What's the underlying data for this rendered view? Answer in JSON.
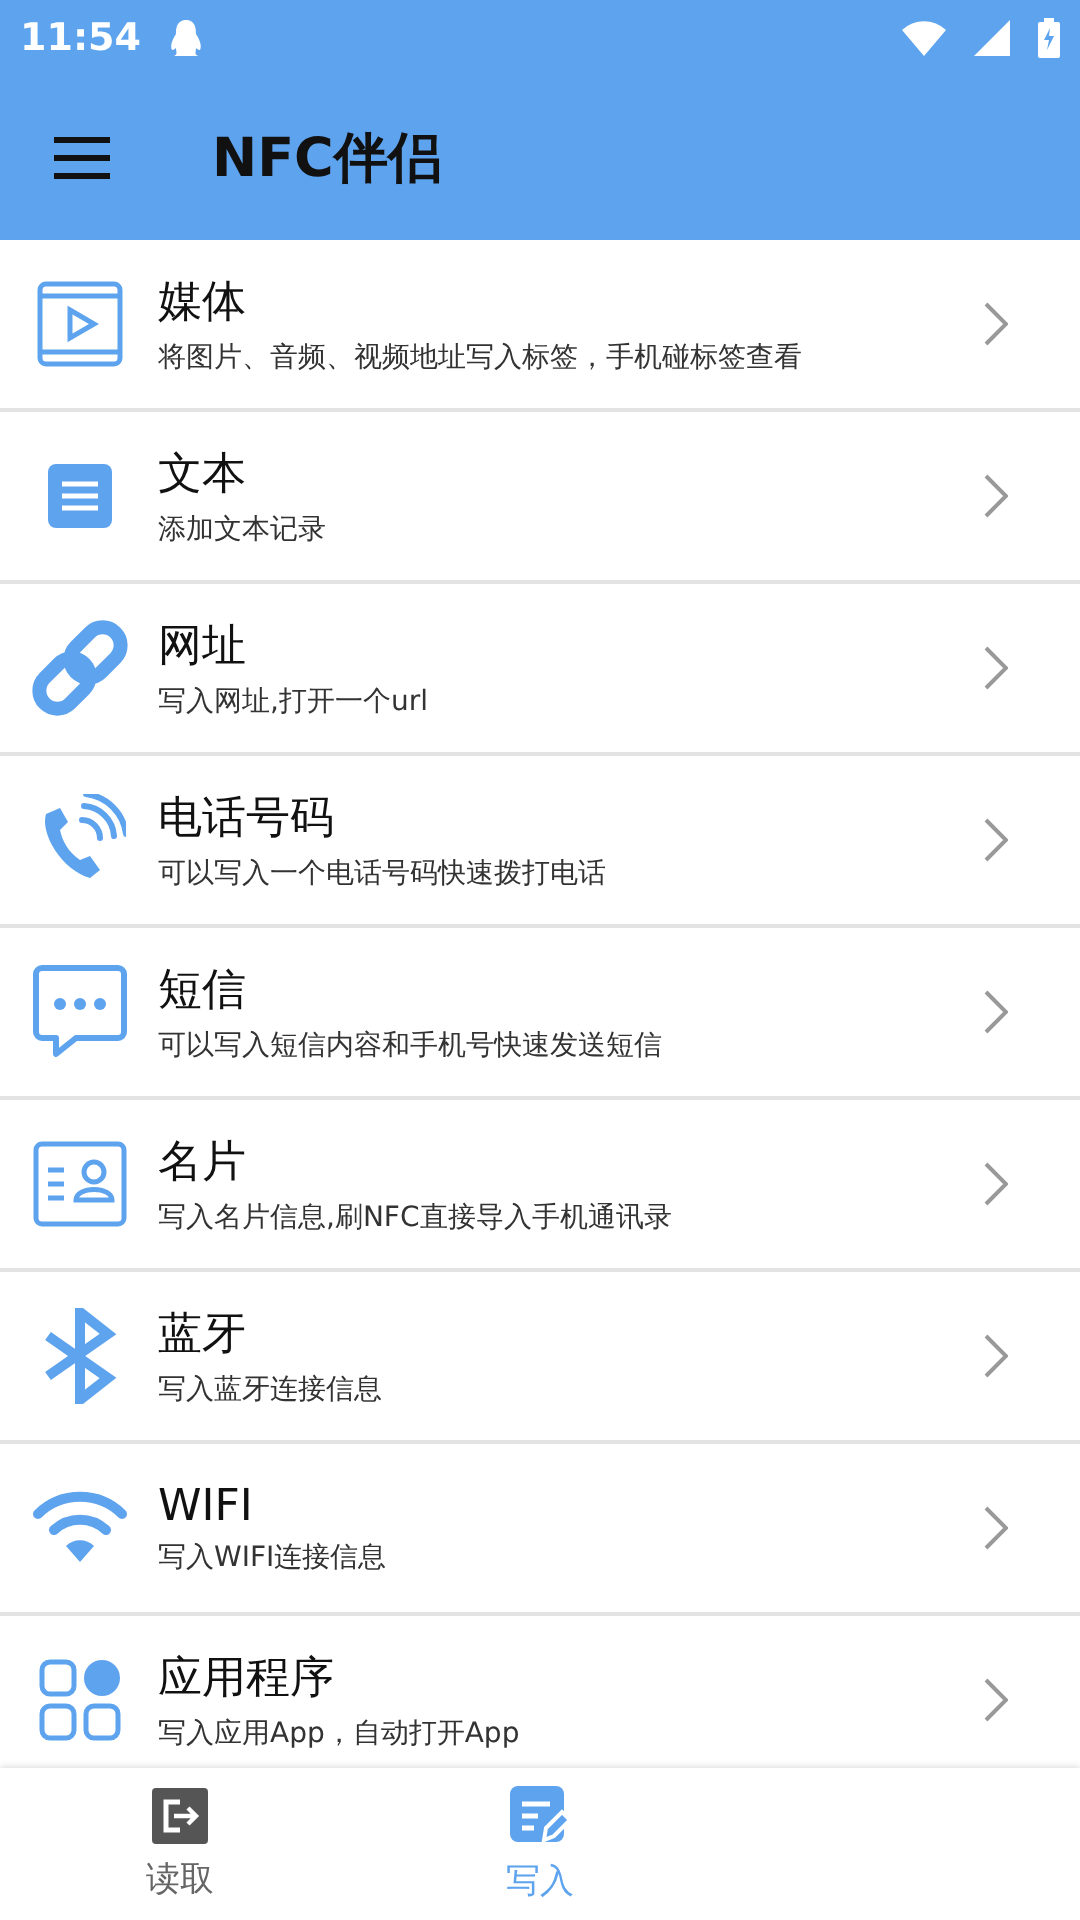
{
  "status_bar": {
    "time": "11:54"
  },
  "app_bar": {
    "title": "NFC伴侣"
  },
  "items": [
    {
      "kind": "media",
      "title": "媒体",
      "subtitle": "将图片、音频、视频地址写入标签，手机碰标签查看"
    },
    {
      "kind": "text",
      "title": "文本",
      "subtitle": "添加文本记录"
    },
    {
      "kind": "link",
      "title": "网址",
      "subtitle": "写入网址,打开一个url"
    },
    {
      "kind": "phone",
      "title": "电话号码",
      "subtitle": "可以写入一个电话号码快速拨打电话"
    },
    {
      "kind": "sms",
      "title": "短信",
      "subtitle": "可以写入短信内容和手机号快速发送短信"
    },
    {
      "kind": "card",
      "title": "名片",
      "subtitle": "写入名片信息,刷NFC直接导入手机通讯录"
    },
    {
      "kind": "bluetooth",
      "title": "蓝牙",
      "subtitle": "写入蓝牙连接信息"
    },
    {
      "kind": "wifi",
      "title": "WIFI",
      "subtitle": "写入WIFI连接信息"
    },
    {
      "kind": "apps",
      "title": "应用程序",
      "subtitle": "写入应用App，自动打开App"
    }
  ],
  "bottom_nav": [
    {
      "kind": "read",
      "label": "读取",
      "selected": false
    },
    {
      "kind": "write",
      "label": "写入",
      "selected": true
    }
  ]
}
